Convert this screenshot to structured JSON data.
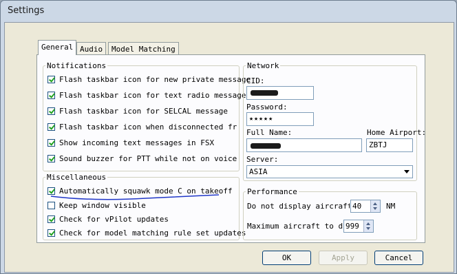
{
  "window": {
    "title": "Settings"
  },
  "tabs": [
    {
      "label": "General",
      "active": true
    },
    {
      "label": "Audio",
      "active": false
    },
    {
      "label": "Model Matching",
      "active": false
    }
  ],
  "notifications": {
    "legend": "Notifications",
    "items": [
      {
        "label": "Flash taskbar icon for new private message",
        "checked": true
      },
      {
        "label": "Flash taskbar icon for text radio message",
        "checked": true
      },
      {
        "label": "Flash taskbar icon for SELCAL message",
        "checked": true
      },
      {
        "label": "Flash taskbar icon when disconnected from n",
        "checked": true
      },
      {
        "label": "Show incoming text messages in FSX",
        "checked": true
      },
      {
        "label": "Sound buzzer for PTT while not on voice",
        "checked": true
      }
    ]
  },
  "misc": {
    "legend": "Miscellaneous",
    "items": [
      {
        "label": "Automatically squawk mode C on takeoff",
        "checked": true
      },
      {
        "label": "Keep window visible",
        "checked": false
      },
      {
        "label": "Check for vPilot updates",
        "checked": true
      },
      {
        "label": "Check for model matching rule set updates",
        "checked": true
      }
    ]
  },
  "network": {
    "legend": "Network",
    "cid_label": "CID:",
    "password_label": "Password:",
    "password_value": "★★★★★",
    "fullname_label": "Full Name:",
    "home_label": "Home Airport:",
    "home_value": "ZBTJ",
    "server_label": "Server:",
    "server_value": "ASIA"
  },
  "performance": {
    "legend": "Performance",
    "distance_label": "Do not display aircraft b",
    "distance_value": "40",
    "distance_unit": "NM",
    "max_label": "Maximum aircraft to disp",
    "max_value": "999"
  },
  "buttons": {
    "ok": "OK",
    "apply": "Apply",
    "cancel": "Cancel"
  },
  "colors": {
    "annotation": "#1f36c8",
    "checkmark": "#21a121"
  }
}
